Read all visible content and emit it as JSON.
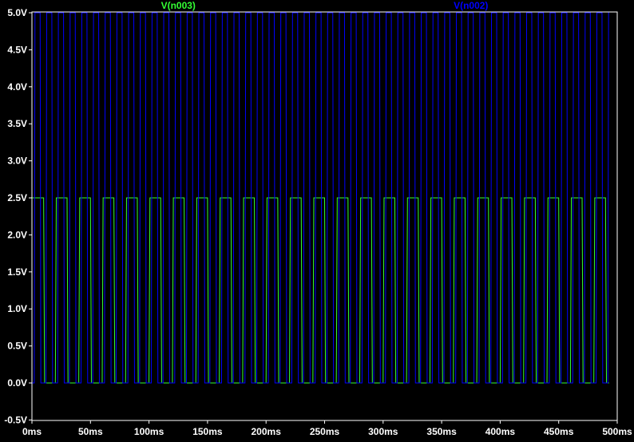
{
  "chart_data": {
    "type": "line",
    "title": "",
    "xlabel": "",
    "ylabel": "",
    "x_tick_labels": [
      "0ms",
      "50ms",
      "100ms",
      "150ms",
      "200ms",
      "250ms",
      "300ms",
      "350ms",
      "400ms",
      "450ms",
      "500ms"
    ],
    "y_tick_labels": [
      "-0.5V",
      "0.0V",
      "0.5V",
      "1.0V",
      "1.5V",
      "2.0V",
      "2.5V",
      "3.0V",
      "3.5V",
      "4.0V",
      "4.5V",
      "5.0V"
    ],
    "x_ticks_ms": [
      0,
      50,
      100,
      150,
      200,
      250,
      300,
      350,
      400,
      450,
      500
    ],
    "y_ticks_v": [
      -0.5,
      0,
      0.5,
      1.0,
      1.5,
      2.0,
      2.5,
      3.0,
      3.5,
      4.0,
      4.5,
      5.0
    ],
    "xlim": [
      0,
      500
    ],
    "ylim": [
      -0.5,
      5.0
    ],
    "grid": false,
    "legend": "top",
    "series": [
      {
        "name": "V(n003)",
        "color": "#33ff33",
        "waveform": "square",
        "low": 0,
        "high": 2.5,
        "period_ms": 20,
        "high_ms": 10,
        "first_edge_ms": 10,
        "rise_ms": 0.8,
        "start_level": "high",
        "x_end_ms": 493
      },
      {
        "name": "V(n002)",
        "color": "#0000ff",
        "waveform": "square",
        "low": 0,
        "high": 5.0,
        "period_ms": 10,
        "high_ms": 5,
        "first_edge_ms": 2,
        "rise_ms": 0.6,
        "start_level": "low",
        "x_end_ms": 493
      }
    ]
  }
}
